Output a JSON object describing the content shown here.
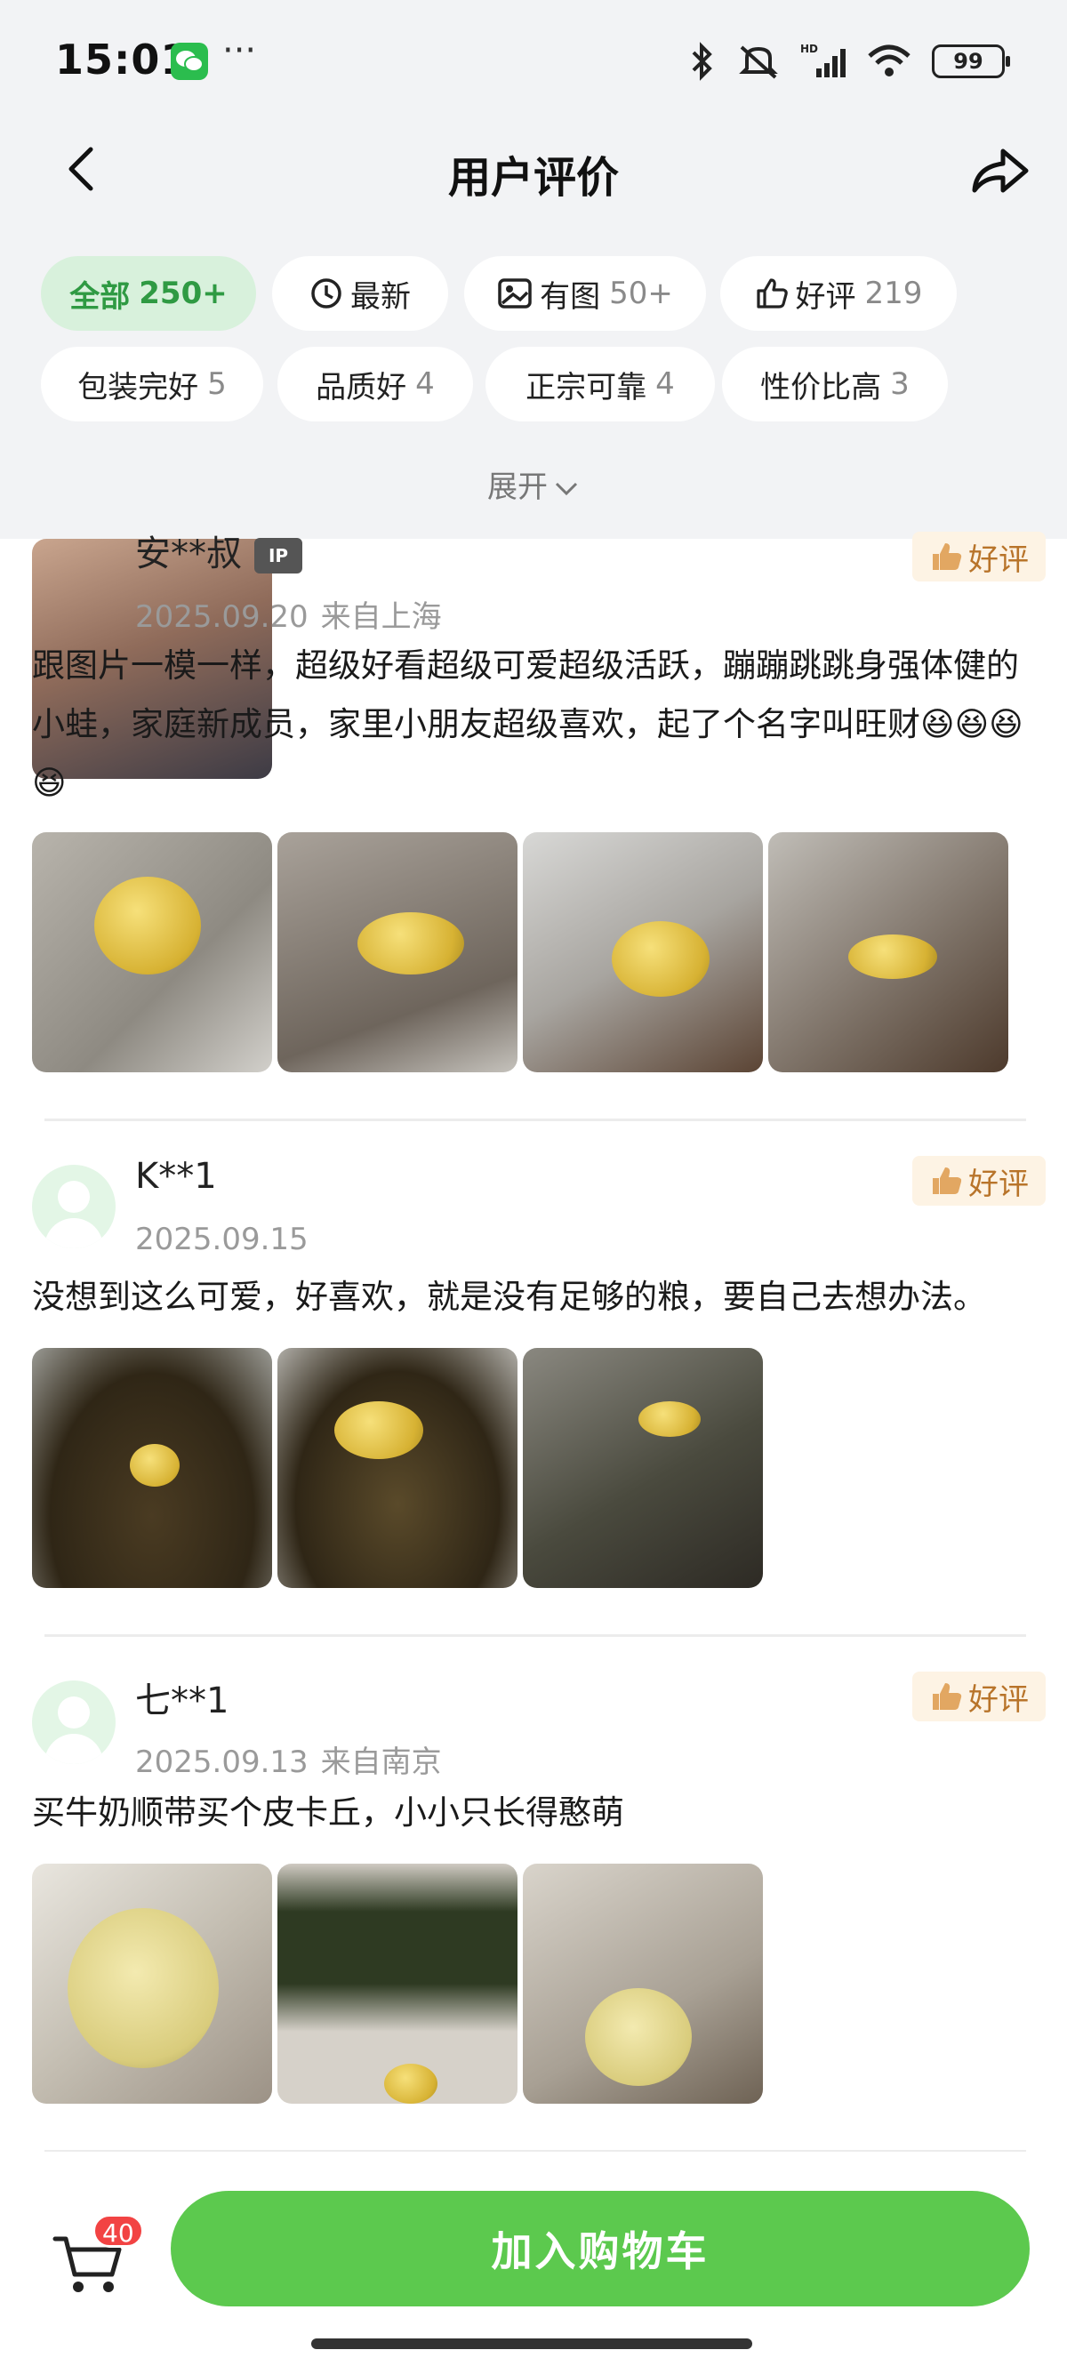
{
  "status_bar": {
    "time": "15:01",
    "battery": "99"
  },
  "nav": {
    "title": "用户评价"
  },
  "filters": [
    {
      "label": "全部",
      "count": "250+",
      "active": true
    },
    {
      "label": "最新",
      "count": ""
    },
    {
      "label": "有图",
      "count": "50+"
    },
    {
      "label": "好评",
      "count": "219"
    },
    {
      "label": "包装完好",
      "count": "5"
    },
    {
      "label": "品质好",
      "count": "4"
    },
    {
      "label": "正宗可靠",
      "count": "4"
    },
    {
      "label": "性价比高",
      "count": "3"
    }
  ],
  "expand_label": "展开",
  "reviews": [
    {
      "username": "安**叔",
      "badge": "IP",
      "date": "2025.09.20",
      "location": "来自上海",
      "rating_label": "好评",
      "text": "跟图片一模一样，超级好看超级可爱超级活跃，蹦蹦跳跳身强体健的小蛙，家庭新成员，家里小朋友超级喜欢，起了个名字叫旺财😆😆😆😆",
      "photo_count": 4
    },
    {
      "username": "K**1",
      "date": "2025.09.15",
      "location": "",
      "rating_label": "好评",
      "text": "没想到这么可爱，好喜欢，就是没有足够的粮，要自己去想办法。",
      "photo_count": 3
    },
    {
      "username": "七**1",
      "date": "2025.09.13",
      "location": "来自南京",
      "rating_label": "好评",
      "text": "买牛奶顺带买个皮卡丘，小小只长得憨萌",
      "photo_count": 3
    }
  ],
  "bottom_bar": {
    "cart_count": "40",
    "add_to_cart_label": "加入购物车"
  },
  "colors": {
    "accent_green": "#5cc94e",
    "chip_active_bg": "#d8f1dc",
    "badge_bg": "#fdf3e4",
    "badge_text": "#b8742a",
    "cart_badge": "#f24343"
  }
}
